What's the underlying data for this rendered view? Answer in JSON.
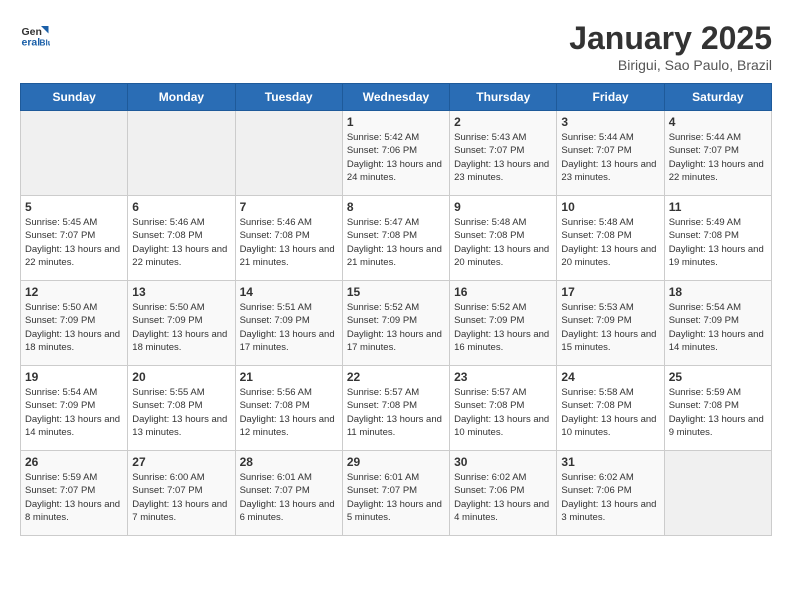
{
  "logo": {
    "general": "General",
    "blue": "Blue"
  },
  "header": {
    "title": "January 2025",
    "subtitle": "Birigui, Sao Paulo, Brazil"
  },
  "weekdays": [
    "Sunday",
    "Monday",
    "Tuesday",
    "Wednesday",
    "Thursday",
    "Friday",
    "Saturday"
  ],
  "weeks": [
    [
      {
        "day": "",
        "empty": true
      },
      {
        "day": "",
        "empty": true
      },
      {
        "day": "",
        "empty": true
      },
      {
        "day": "1",
        "sunrise": "5:42 AM",
        "sunset": "7:06 PM",
        "daylight": "13 hours and 24 minutes."
      },
      {
        "day": "2",
        "sunrise": "5:43 AM",
        "sunset": "7:07 PM",
        "daylight": "13 hours and 23 minutes."
      },
      {
        "day": "3",
        "sunrise": "5:44 AM",
        "sunset": "7:07 PM",
        "daylight": "13 hours and 23 minutes."
      },
      {
        "day": "4",
        "sunrise": "5:44 AM",
        "sunset": "7:07 PM",
        "daylight": "13 hours and 22 minutes."
      }
    ],
    [
      {
        "day": "5",
        "sunrise": "5:45 AM",
        "sunset": "7:07 PM",
        "daylight": "13 hours and 22 minutes."
      },
      {
        "day": "6",
        "sunrise": "5:46 AM",
        "sunset": "7:08 PM",
        "daylight": "13 hours and 22 minutes."
      },
      {
        "day": "7",
        "sunrise": "5:46 AM",
        "sunset": "7:08 PM",
        "daylight": "13 hours and 21 minutes."
      },
      {
        "day": "8",
        "sunrise": "5:47 AM",
        "sunset": "7:08 PM",
        "daylight": "13 hours and 21 minutes."
      },
      {
        "day": "9",
        "sunrise": "5:48 AM",
        "sunset": "7:08 PM",
        "daylight": "13 hours and 20 minutes."
      },
      {
        "day": "10",
        "sunrise": "5:48 AM",
        "sunset": "7:08 PM",
        "daylight": "13 hours and 20 minutes."
      },
      {
        "day": "11",
        "sunrise": "5:49 AM",
        "sunset": "7:08 PM",
        "daylight": "13 hours and 19 minutes."
      }
    ],
    [
      {
        "day": "12",
        "sunrise": "5:50 AM",
        "sunset": "7:09 PM",
        "daylight": "13 hours and 18 minutes."
      },
      {
        "day": "13",
        "sunrise": "5:50 AM",
        "sunset": "7:09 PM",
        "daylight": "13 hours and 18 minutes."
      },
      {
        "day": "14",
        "sunrise": "5:51 AM",
        "sunset": "7:09 PM",
        "daylight": "13 hours and 17 minutes."
      },
      {
        "day": "15",
        "sunrise": "5:52 AM",
        "sunset": "7:09 PM",
        "daylight": "13 hours and 17 minutes."
      },
      {
        "day": "16",
        "sunrise": "5:52 AM",
        "sunset": "7:09 PM",
        "daylight": "13 hours and 16 minutes."
      },
      {
        "day": "17",
        "sunrise": "5:53 AM",
        "sunset": "7:09 PM",
        "daylight": "13 hours and 15 minutes."
      },
      {
        "day": "18",
        "sunrise": "5:54 AM",
        "sunset": "7:09 PM",
        "daylight": "13 hours and 14 minutes."
      }
    ],
    [
      {
        "day": "19",
        "sunrise": "5:54 AM",
        "sunset": "7:09 PM",
        "daylight": "13 hours and 14 minutes."
      },
      {
        "day": "20",
        "sunrise": "5:55 AM",
        "sunset": "7:08 PM",
        "daylight": "13 hours and 13 minutes."
      },
      {
        "day": "21",
        "sunrise": "5:56 AM",
        "sunset": "7:08 PM",
        "daylight": "13 hours and 12 minutes."
      },
      {
        "day": "22",
        "sunrise": "5:57 AM",
        "sunset": "7:08 PM",
        "daylight": "13 hours and 11 minutes."
      },
      {
        "day": "23",
        "sunrise": "5:57 AM",
        "sunset": "7:08 PM",
        "daylight": "13 hours and 10 minutes."
      },
      {
        "day": "24",
        "sunrise": "5:58 AM",
        "sunset": "7:08 PM",
        "daylight": "13 hours and 10 minutes."
      },
      {
        "day": "25",
        "sunrise": "5:59 AM",
        "sunset": "7:08 PM",
        "daylight": "13 hours and 9 minutes."
      }
    ],
    [
      {
        "day": "26",
        "sunrise": "5:59 AM",
        "sunset": "7:07 PM",
        "daylight": "13 hours and 8 minutes."
      },
      {
        "day": "27",
        "sunrise": "6:00 AM",
        "sunset": "7:07 PM",
        "daylight": "13 hours and 7 minutes."
      },
      {
        "day": "28",
        "sunrise": "6:01 AM",
        "sunset": "7:07 PM",
        "daylight": "13 hours and 6 minutes."
      },
      {
        "day": "29",
        "sunrise": "6:01 AM",
        "sunset": "7:07 PM",
        "daylight": "13 hours and 5 minutes."
      },
      {
        "day": "30",
        "sunrise": "6:02 AM",
        "sunset": "7:06 PM",
        "daylight": "13 hours and 4 minutes."
      },
      {
        "day": "31",
        "sunrise": "6:02 AM",
        "sunset": "7:06 PM",
        "daylight": "13 hours and 3 minutes."
      },
      {
        "day": "",
        "empty": true
      }
    ]
  ]
}
